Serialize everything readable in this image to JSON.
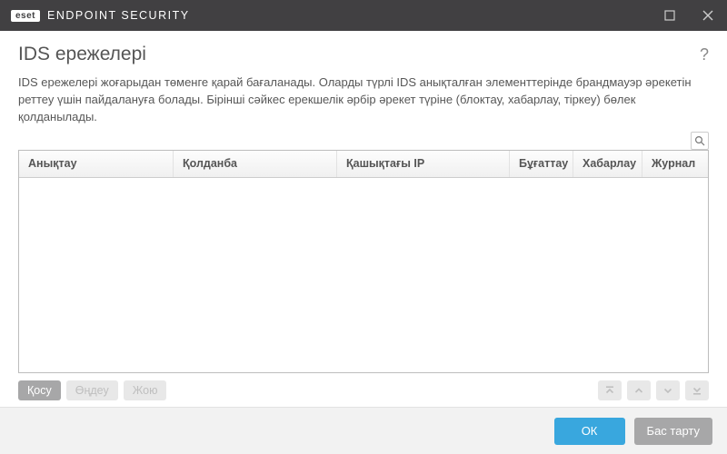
{
  "titlebar": {
    "brand_badge": "eset",
    "brand_name": "ENDPOINT SECURITY"
  },
  "page": {
    "title": "IDS ережелері",
    "help": "?",
    "description": "IDS ережелері жоғарыдан төменге қарай бағаланады. Оларды түрлі IDS анықталған элементтерінде брандмауэр әрекетін реттеу үшін пайдалануға болады. Бірінші сәйкес ерекшелік әрбір әрекет түріне (блоктау, хабарлау, тіркеу) бөлек қолданылады."
  },
  "table": {
    "headers": {
      "detect": "Анықтау",
      "app": "Қолданба",
      "ip": "Қашықтағы IP",
      "block": "Бұғаттау",
      "notify": "Хабарлау",
      "log": "Журнал"
    },
    "rows": []
  },
  "actions": {
    "add": "Қосу",
    "edit": "Өңдеу",
    "delete": "Жою"
  },
  "footer": {
    "ok": "ОК",
    "cancel": "Бас тарту"
  }
}
